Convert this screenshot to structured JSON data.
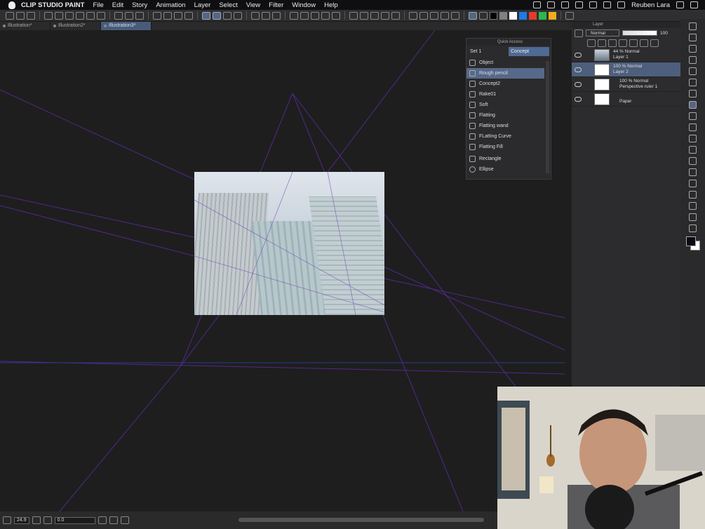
{
  "menubar": {
    "app_name": "CLIP STUDIO PAINT",
    "items": [
      "File",
      "Edit",
      "Story",
      "Animation",
      "Layer",
      "Select",
      "View",
      "Filter",
      "Window",
      "Help"
    ],
    "user": "Reuben Lara"
  },
  "toolbar": {
    "swatch_colors": [
      "#000000",
      "#808080",
      "#ffffff",
      "#1e7be6",
      "#e23b2a",
      "#2db84d",
      "#f3ac1b"
    ]
  },
  "tabs": [
    {
      "label": "Illustration*",
      "active": false
    },
    {
      "label": "Illustration2*",
      "active": false
    },
    {
      "label": "Illustration3*",
      "active": true
    }
  ],
  "quick_access": {
    "title": "Quick Access",
    "sets": [
      "Set 1",
      "Concept"
    ],
    "active_set": "Concept",
    "items": [
      {
        "label": "Object",
        "icon": "object-icon"
      },
      {
        "label": "Rough pencil",
        "icon": "pencil-icon",
        "selected": true
      },
      {
        "label": "Concept2",
        "icon": "pencil-icon"
      },
      {
        "label": "Rake01",
        "icon": "pencil-icon"
      },
      {
        "label": "Soft",
        "icon": "airbrush-icon"
      },
      {
        "label": "Flatting",
        "icon": "pen-icon"
      },
      {
        "label": "Flatting wand",
        "icon": "magic-wand-icon"
      },
      {
        "label": "FLatting Curve",
        "icon": "curve-icon"
      },
      {
        "label": "Flatting Fill",
        "icon": "fill-icon"
      },
      {
        "label": "Rectangle",
        "icon": "rectangle-icon"
      },
      {
        "label": "Ellipse",
        "icon": "ellipse-icon"
      }
    ]
  },
  "layer_panel": {
    "title": "Layer",
    "blend_mode": "Normal",
    "opacity": "100",
    "layers": [
      {
        "line1": "44 % Normal",
        "line2": "Layer 1",
        "selected": false,
        "thumb": "photo"
      },
      {
        "line1": "100 % Normal",
        "line2": "Layer 2",
        "selected": true,
        "thumb": "white"
      },
      {
        "line1": "100 % Normal",
        "line2": "Perspective ruler 1",
        "selected": false,
        "thumb": "white"
      },
      {
        "line1": "",
        "line2": "Paper",
        "selected": false,
        "thumb": "white"
      }
    ]
  },
  "statusbar": {
    "zoom": "24.9",
    "angle": "0.0"
  },
  "colors": {
    "accent": "#566582",
    "perspective_line": "#6a2fb4"
  }
}
